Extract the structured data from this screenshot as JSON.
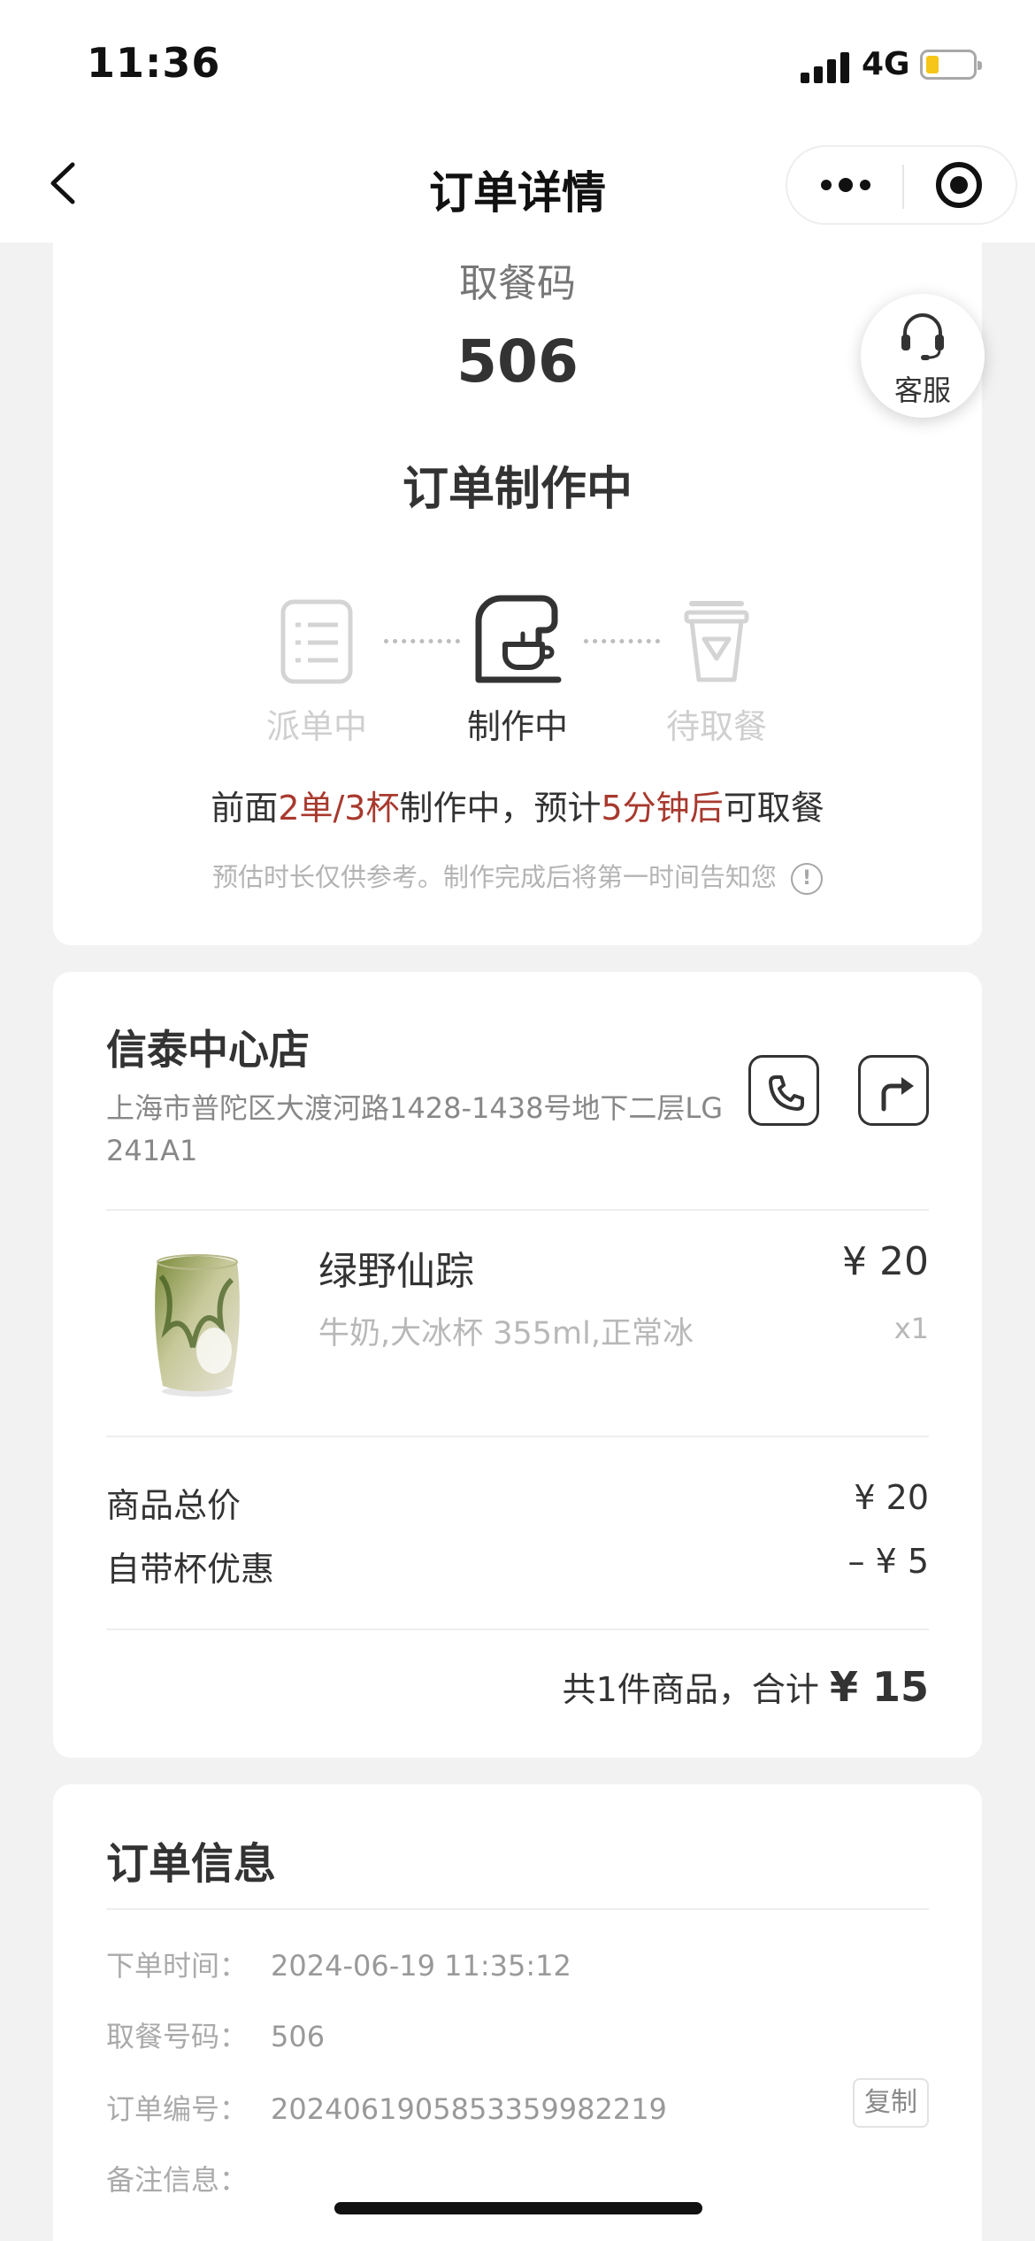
{
  "status_bar": {
    "time": "11:36",
    "network": "4G"
  },
  "nav": {
    "title": "订单详情"
  },
  "status_card": {
    "pickup_label": "取餐码",
    "pickup_code": "506",
    "order_state": "订单制作中",
    "service_label": "客服",
    "steps": [
      {
        "label": "派单中",
        "icon": "list-icon",
        "active": false
      },
      {
        "label": "制作中",
        "icon": "coffee-machine-icon",
        "active": true
      },
      {
        "label": "待取餐",
        "icon": "cup-icon",
        "active": false
      }
    ],
    "queue": {
      "prefix": "前面",
      "count": "2单/3杯",
      "middle": "制作中，预计",
      "time": "5分钟后",
      "suffix": "可取餐"
    },
    "estimate_note": "预估时长仅供参考。制作完成后将第一时间告知您",
    "info_icon": "!",
    "accent_color": "#a8392e"
  },
  "store": {
    "name": "信泰中心店",
    "address": "上海市普陀区大渡河路1428-1438号地下二层LG241A1",
    "product": {
      "name": "绿野仙踪",
      "spec": "牛奶,大冰杯 355ml,正常冰",
      "price": "¥ 20",
      "qty": "x1"
    },
    "summary": {
      "subtotal_label": "商品总价",
      "subtotal_value": "¥ 20",
      "discount_label": "自带杯优惠",
      "discount_value": "–  ¥ 5",
      "total_prefix": "共1件商品，合计",
      "total_amount": "¥ 15"
    }
  },
  "order_info": {
    "title": "订单信息",
    "rows": [
      {
        "key": "下单时间：",
        "value": "2024-06-19 11:35:12"
      },
      {
        "key": "取餐号码：",
        "value": "506"
      },
      {
        "key": "订单编号：",
        "value": "20240619058533599822​19"
      },
      {
        "key": "备注信息：",
        "value": ""
      }
    ],
    "copy_label": "复制"
  }
}
